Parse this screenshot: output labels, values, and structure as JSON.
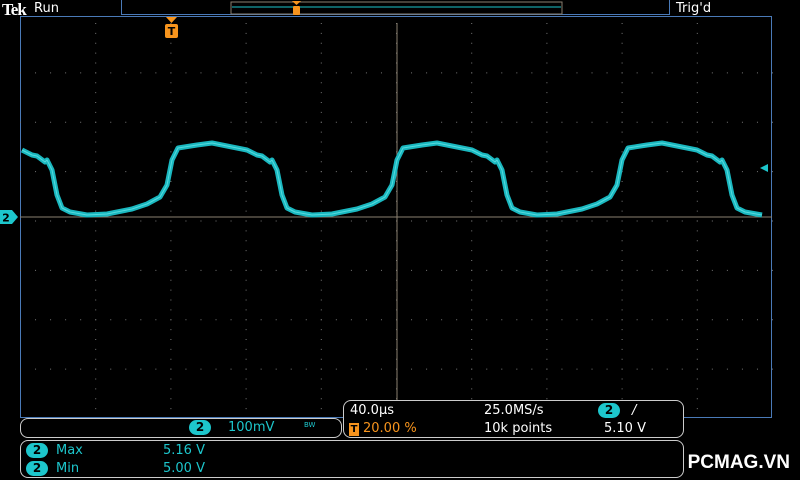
{
  "header": {
    "brand": "Tek",
    "status": "Run",
    "trigger_status": "Trig'd"
  },
  "channel": {
    "badge": "2",
    "scale": "100mV",
    "bw": "BW",
    "color": "#1dc6cc"
  },
  "timebase": {
    "horizontal_scale": "40.0µs",
    "sample_rate": "25.0MS/s",
    "trigger_position": "20.00 %",
    "record_length": "10k points",
    "trigger_channel": "2",
    "trigger_slope": "/",
    "trigger_level": "5.10 V",
    "trigger_marker": "T"
  },
  "measurements": [
    {
      "channel": "2",
      "label": "Max",
      "value": "5.16 V"
    },
    {
      "channel": "2",
      "label": "Min",
      "value": "5.00 V"
    }
  ],
  "watermark": "PCMAG.VN"
}
